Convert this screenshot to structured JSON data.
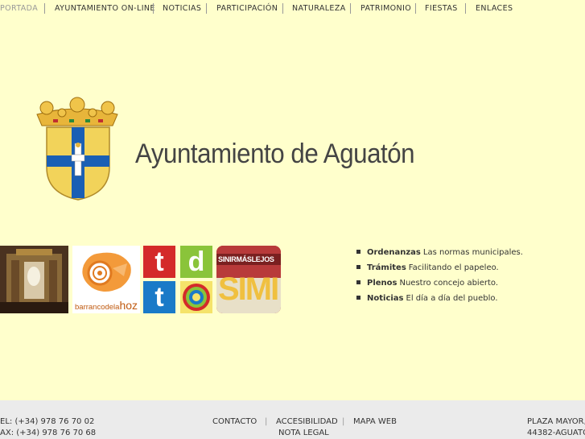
{
  "nav": {
    "items": [
      "PORTADA",
      "AYUNTAMIENTO ON-LINE",
      "NOTICIAS",
      "PARTICIPACIÓN",
      "NATURALEZA",
      "PATRIMONIO",
      "FIESTAS",
      "ENLACES"
    ]
  },
  "header": {
    "title": "Ayuntamiento de Aguatón"
  },
  "banners": {
    "hoz_text_a": "barrancodela",
    "hoz_text_b": "hoz",
    "tdt": [
      "t",
      "d",
      "t"
    ],
    "simi_top": "SINIRMÁSLEJOS",
    "simi_big": "SIMI"
  },
  "quick_links": [
    {
      "key": "Ordenanzas",
      "desc": "Las normas municipales."
    },
    {
      "key": "Trámites",
      "desc": "Facilitando el papeleo."
    },
    {
      "key": "Plenos",
      "desc": "Nuestro concejo abierto."
    },
    {
      "key": "Noticias",
      "desc": "El día a día del pueblo."
    }
  ],
  "footer": {
    "phone": "EL: (+34) 978 76 70 02",
    "fax": "AX: (+34) 978 76 70 68",
    "links": [
      "CONTACTO",
      "ACCESIBILIDAD",
      "MAPA WEB"
    ],
    "legal": "NOTA LEGAL",
    "address1": "PLAZA MAYOR,",
    "address2": "44382-AGUATÓ"
  },
  "colors": {
    "background": "#ffffcc",
    "footer": "#ebebeb",
    "shield_blue": "#1a5fb4",
    "shield_gold": "#f2d35a"
  }
}
